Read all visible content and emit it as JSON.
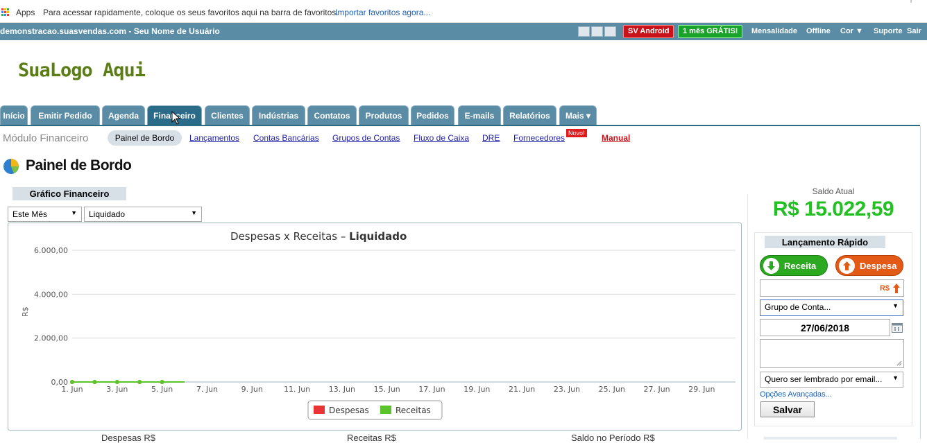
{
  "bookmarks_bar": {
    "apps_label": "Apps",
    "hint": "Para acessar rapidamente, coloque os seus favoritos aqui na barra de favoritos.",
    "import_link": "Importar favoritos agora..."
  },
  "topbar": {
    "domain": "demonstracao.suasvendas.com - Seu Nome de Usuário",
    "android_badge": "SV Android",
    "trial_badge": "1 mês GRÁTIS!",
    "links": [
      "Mensalidade",
      "Offline",
      "Cor ▼",
      "Suporte",
      "Sair"
    ]
  },
  "logo": "SuaLogo Aqui",
  "tabs": [
    {
      "label": "Início"
    },
    {
      "label": "Emitir Pedido"
    },
    {
      "label": "Agenda"
    },
    {
      "label": "Financeiro",
      "active": true
    },
    {
      "label": "Clientes"
    },
    {
      "label": "Indústrias"
    },
    {
      "label": "Contatos"
    },
    {
      "label": "Produtos"
    },
    {
      "label": "Pedidos"
    },
    {
      "label": "E-mails"
    },
    {
      "label": "Relatórios"
    },
    {
      "label": "Mais ▾"
    }
  ],
  "submenu": {
    "module": "Módulo Financeiro",
    "active": "Painel de Bordo",
    "links": [
      "Lançamentos",
      "Contas Bancárias",
      "Grupos de Contas",
      "Fluxo de Caixa",
      "DRE",
      "Fornecedores"
    ],
    "novo_badge": "Novo!",
    "manual": "Manual"
  },
  "page": {
    "title": "Painel de Bordo"
  },
  "chart_section": {
    "header": "Gráfico Financeiro",
    "period_select": "Este Mês",
    "type_select": "Liquidado",
    "bottom_labels": [
      "Despesas R$",
      "Receitas R$",
      "Saldo no Período R$"
    ]
  },
  "chart_data": {
    "type": "area",
    "title": "Despesas x Receitas – ",
    "title_bold": "Liquidado",
    "ylabel": "R$",
    "ylim": [
      0,
      6000
    ],
    "yticks": [
      "0,00",
      "2.000,00",
      "4.000,00",
      "6.000,00"
    ],
    "ytick_values": [
      0,
      2000,
      4000,
      6000
    ],
    "x_tick_labels": [
      "1. Jun",
      "3. Jun",
      "5. Jun",
      "7. Jun",
      "9. Jun",
      "11. Jun",
      "13. Jun",
      "15. Jun",
      "17. Jun",
      "19. Jun",
      "21. Jun",
      "23. Jun",
      "25. Jun",
      "27. Jun",
      "29. Jun"
    ],
    "x_tick_days": [
      1,
      3,
      5,
      7,
      9,
      11,
      13,
      15,
      17,
      19,
      21,
      23,
      25,
      27,
      29
    ],
    "x_days": [
      1,
      2,
      3,
      4,
      5,
      6
    ],
    "series": [
      {
        "name": "Despesas",
        "color": "#e83434",
        "values": [
          0,
          0,
          0,
          0,
          0,
          0
        ]
      },
      {
        "name": "Receitas",
        "color": "#5ac42a",
        "values": [
          0,
          0,
          0,
          0,
          0,
          0
        ]
      }
    ],
    "legend": "bottom-center"
  },
  "right_panel": {
    "saldo_label": "Saldo Atual",
    "saldo_value": "R$ 15.022,59",
    "saldo_color": "#22c022",
    "quick_header": "Lançamento Rápido",
    "receita_button": "Receita",
    "despesa_button": "Despesa",
    "currency": "R$",
    "grupo_select": "Grupo de Conta...",
    "date": "27/06/2018",
    "lembrar_select": "Quero ser lembrado por email...",
    "advanced": "Opções Avançadas...",
    "save": "Salvar"
  }
}
